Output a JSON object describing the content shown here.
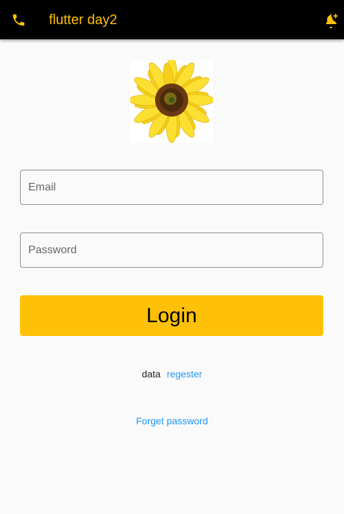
{
  "app_bar": {
    "title": "flutter day2",
    "leading_icon": "phone-icon",
    "action_icon": "notification-add-icon",
    "background_color": "#000000",
    "accent_color": "#ffc107"
  },
  "logo": {
    "icon": "sunflower-image"
  },
  "form": {
    "email_placeholder": "Email",
    "email_value": "",
    "password_placeholder": "Password",
    "password_value": "",
    "login_label": "Login",
    "login_color": "#ffc107"
  },
  "register": {
    "prefix": "data",
    "link_label": "regester"
  },
  "forgot": {
    "link_label": "Forget password"
  },
  "colors": {
    "link": "#2196f3",
    "background": "#fafafa"
  }
}
